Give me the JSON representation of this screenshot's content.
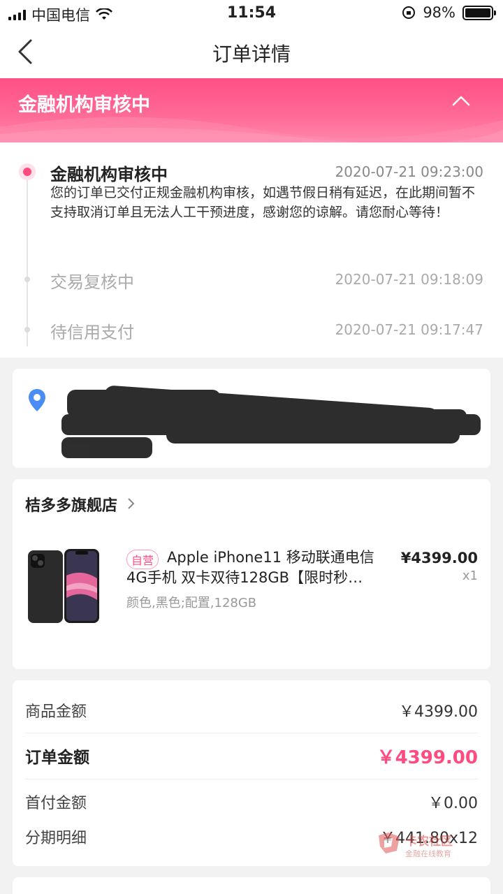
{
  "status_bar": {
    "carrier": "中国电信",
    "time": "11:54",
    "battery": "98%"
  },
  "nav": {
    "title": "订单详情"
  },
  "banner": {
    "title": "金融机构审核中"
  },
  "timeline": [
    {
      "status": "金融机构审核中",
      "time": "2020-07-21 09:23:00",
      "desc": "您的订单已交付正规金融机构审核，如遇节假日稍有延迟，在此期间暂不支持取消订单且无法人工干预进度，感谢您的谅解。请您耐心等待！"
    },
    {
      "status": "交易复核中",
      "time": "2020-07-21 09:18:09"
    },
    {
      "status": "待信用支付",
      "time": "2020-07-21 09:17:47"
    }
  ],
  "store": {
    "name": "桔多多旗舰店"
  },
  "product": {
    "tag": "自营",
    "name": "Apple iPhone11 移动联通电信4G手机 双卡双待128GB【限时秒…",
    "attrs": "颜色,黑色;配置,128GB",
    "price": "¥4399.00",
    "qty": "x1"
  },
  "amounts": {
    "goods_label": "商品金额",
    "goods_value": "￥4399.00",
    "order_label": "订单金额",
    "order_value": "￥4399.00",
    "down_label": "首付金额",
    "down_value": "￥0.00",
    "install_label": "分期明细",
    "install_value": "￥441.80x12"
  },
  "watermark": {
    "title": "卡农社区",
    "sub": "金融在线教育"
  },
  "colors": {
    "accent": "#ff4b80",
    "banner": "#ff5a8c"
  }
}
